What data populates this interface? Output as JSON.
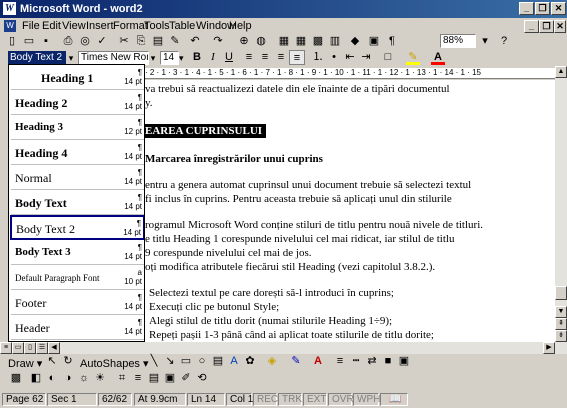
{
  "window": {
    "title": "Microsoft Word - word2",
    "logo": "W",
    "min": "_",
    "restore": "❐",
    "close": "✕"
  },
  "menu": [
    "File",
    "Edit",
    "View",
    "Insert",
    "Format",
    "Tools",
    "Table",
    "Window",
    "Help"
  ],
  "toolbar": {
    "zoom": "88%"
  },
  "format": {
    "style": "Body Text 2",
    "font": "Times New Roman",
    "size": "14",
    "bold": "B",
    "italic": "I",
    "underline": "U"
  },
  "ruler": "· 2 · 1 · 3 · 1 · 4 · 1 · 5 · 1 · 6 · 1 · 7 · 1 · 8 · 1 · 9 · 1 · 10 · 1 · 11 · 1 · 12 · 1 · 13 · 1 · 14 · 1 · 15",
  "style_list": [
    {
      "name": "Heading 1",
      "size": "14 pt"
    },
    {
      "name": "Heading 2",
      "size": "14 pt"
    },
    {
      "name": "Heading 3",
      "size": "12 pt"
    },
    {
      "name": "Heading 4",
      "size": "14 pt"
    },
    {
      "name": "Normal",
      "size": "14 pt"
    },
    {
      "name": "Body Text",
      "size": "14 pt"
    },
    {
      "name": "Body Text 2",
      "size": "14 pt"
    },
    {
      "name": "Body Text 3",
      "size": "14 pt"
    },
    {
      "name": "Default Paragraph Font",
      "size": "10 pt"
    },
    {
      "name": "Footer",
      "size": "14 pt"
    },
    {
      "name": "Header",
      "size": "14 pt"
    }
  ],
  "document": {
    "l1": "va trebui să reactualizezi datele din ele înainte de a tipări documentul",
    "l2": "y.",
    "h1": "EAREA CUPRINSULUI",
    "h2": "Marcarea înregistrărilor unui cuprins",
    "p1a": "entru a genera automat cuprinsul unui document trebuie să selectezi textul",
    "p1b": "fi inclus în cuprins. Pentru aceasta trebuie să aplicați unul din stilurile",
    "p2a": "rogramul Microsoft Word conține stiluri de titlu pentru nouă nivele de titluri.",
    "p2b": "e titlu Heading 1 corespunde nivelului cel mai ridicat, iar stilul de titlu",
    "p2c": "9 corespunde nivelului cel mai de jos.",
    "p2d": "oți modifica atributele fiecărui stil Heading (vezi capitolul 3.8.2.).",
    "b1": "Selectezi textul pe care dorești să-l introduci în cuprins;",
    "b2": "Execuți clic pe butonul Style;",
    "b3": "Alegi stilul de titlu dorit (numai stilurile Heading 1÷9);",
    "b4": "Repeți pașii 1-3 până când ai aplicat toate stilurile de titlu dorite;"
  },
  "drawbar": {
    "draw": "Draw ▾",
    "autoshapes": "AutoShapes ▾"
  },
  "status": {
    "page": "Page 62",
    "sec": "Sec 1",
    "pages": "62/62",
    "at": "At 9.9cm",
    "ln": "Ln 14",
    "col": "Col 1",
    "rec": "REC",
    "trk": "TRK",
    "ext": "EXT",
    "ovr": "OVR",
    "wph": "WPH"
  }
}
